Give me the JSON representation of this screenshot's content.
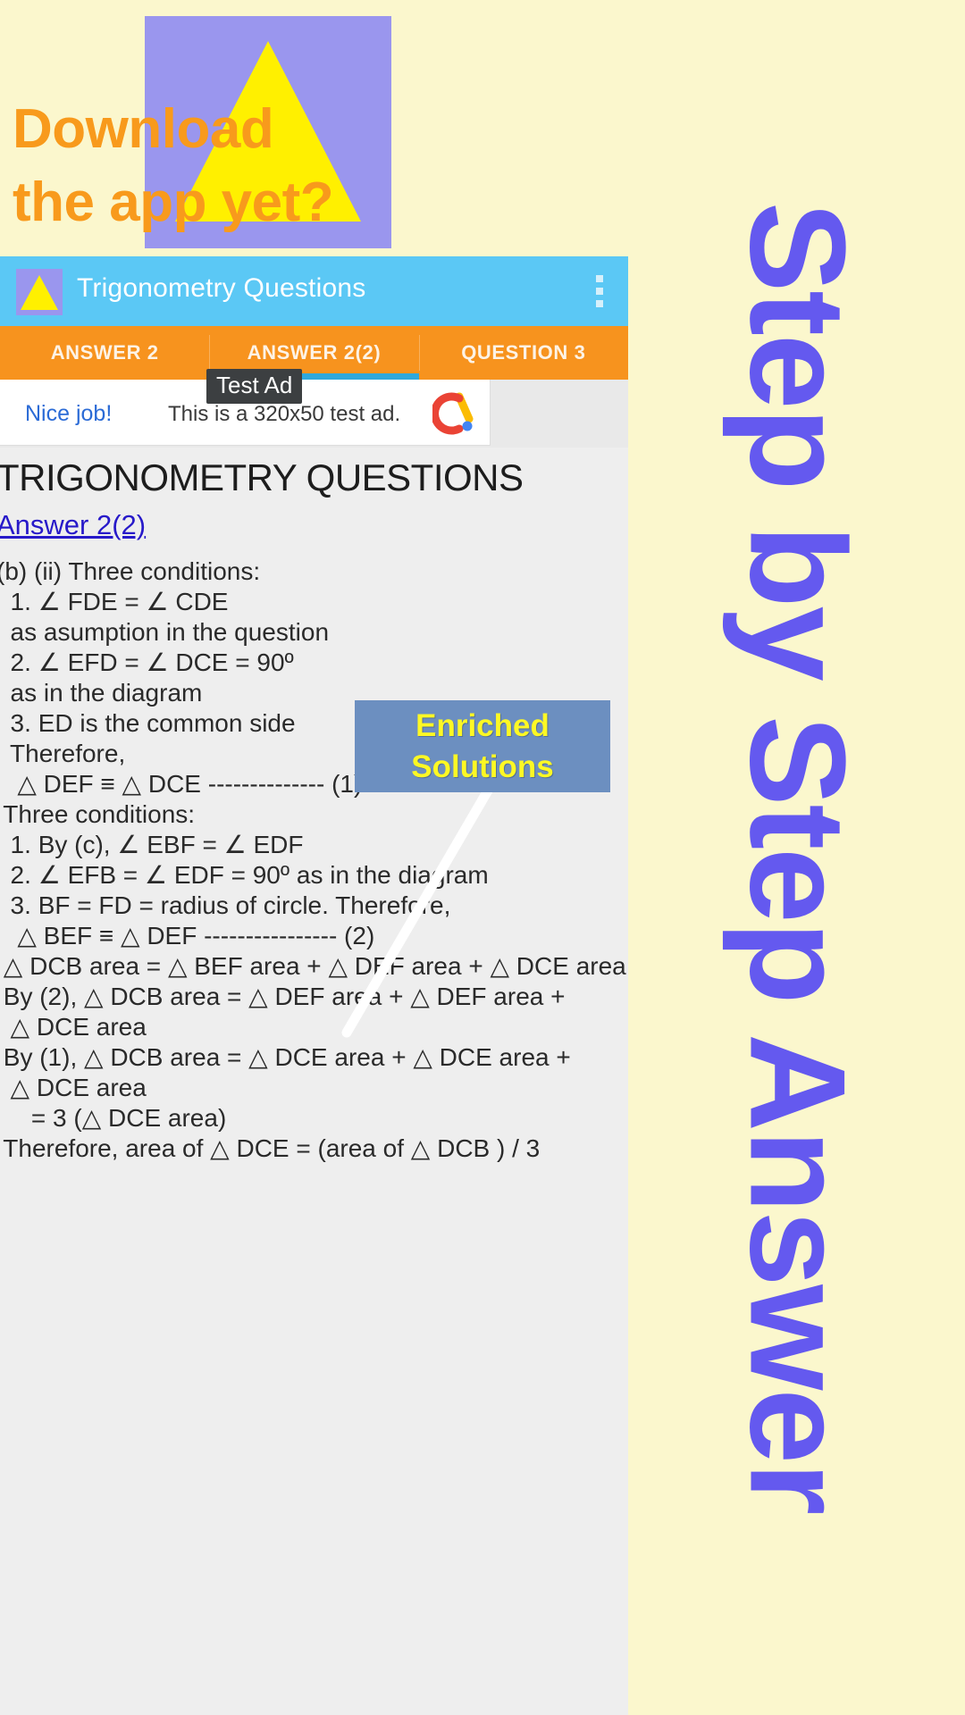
{
  "promo": {
    "headline": "Download\nthe app yet?",
    "logo_icon": "yellow-triangle-logo",
    "text_color": "#f89a1c",
    "background": "#fbf7cd"
  },
  "app": {
    "icon": "app-triangle-icon",
    "title": "Trigonometry Questions",
    "action_bar_color": "#5bc8f5",
    "overflow_icon": "overflow-menu-icon",
    "tabs": [
      {
        "label": "ANSWER 2",
        "selected": false
      },
      {
        "label": "ANSWER 2(2)",
        "selected": true
      },
      {
        "label": "QUESTION 3",
        "selected": false
      }
    ],
    "tab_bar_color": "#f7931e",
    "tab_indicator_color": "#2fa8dc"
  },
  "ad": {
    "test_label": "Test Ad",
    "cta": "Nice job!",
    "body": "This is a 320x50 test ad.",
    "logo_icon": "google-ads-icon",
    "size": "320x50"
  },
  "document": {
    "title": "TRIGONOMETRY QUESTIONS",
    "link": "Answer 2(2)",
    "body": "(b) (ii) Three conditions:\n  1. ∠ FDE = ∠ CDE\n  as asumption in the question\n  2. ∠ EFD = ∠ DCE = 90º\n  as in the diagram\n  3. ED is the common side\n  Therefore,\n   △ DEF ≡ △ DCE -------------- (1)\n Three conditions:\n  1. By (c), ∠ EBF = ∠ EDF\n  2. ∠ EFB = ∠ EDF = 90º as in the diagram\n  3. BF = FD = radius of circle. Therefore,\n   △ BEF ≡ △ DEF ---------------- (2)\n △ DCB area = △ BEF area + △ DEF area + △ DCE area\n By (2), △ DCB area = △ DEF area + △ DEF area +\n  △ DCE area\n By (1), △ DCB area = △ DCE area + △ DCE area +\n  △ DCE area\n     = 3 (△ DCE area)\n Therefore, area of △ DCE = (area of △ DCB ) / 3"
  },
  "callout": {
    "line1": "Enriched",
    "line2": "Solutions",
    "background": "#6c8fc0",
    "text_color": "#fdf824",
    "pointer_icon": "pointer-line"
  },
  "side_banner": {
    "text": "Step by Step Answer",
    "text_color": "#6459ef",
    "background": "#fbf7cd"
  }
}
